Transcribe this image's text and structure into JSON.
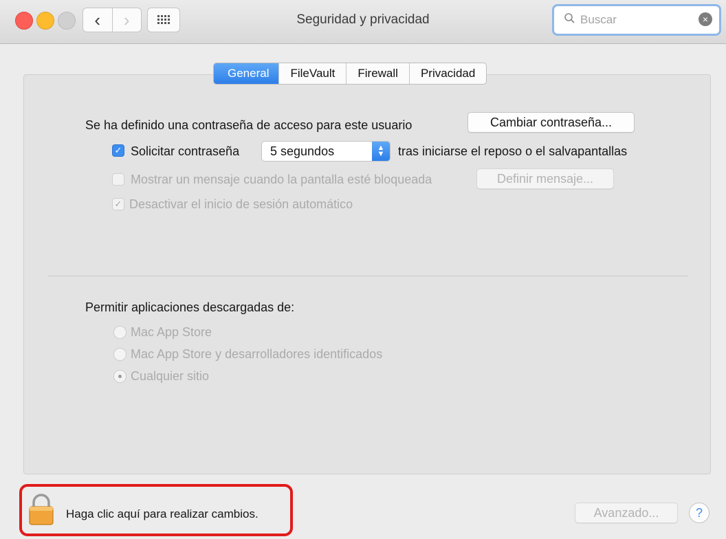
{
  "window": {
    "title": "Seguridad y privacidad",
    "nav_back": "‹",
    "nav_forward": "›"
  },
  "search": {
    "placeholder": "Buscar"
  },
  "tabs": [
    {
      "label": "General",
      "active": true
    },
    {
      "label": "FileVault",
      "active": false
    },
    {
      "label": "Firewall",
      "active": false
    },
    {
      "label": "Privacidad",
      "active": false
    }
  ],
  "general": {
    "password_set_label": "Se ha definido una contraseña de acceso para este usuario",
    "change_password_button": "Cambiar contraseña...",
    "require_password": {
      "label": "Solicitar contraseña",
      "checked": true,
      "delay_value": "5 segundos",
      "suffix": "tras iniciarse el reposo o el salvapantallas"
    },
    "show_message": {
      "label": "Mostrar un mensaje cuando la pantalla esté bloqueada",
      "checked": false,
      "button": "Definir mensaje..."
    },
    "disable_auto_login": {
      "label": "Desactivar el inicio de sesión automático",
      "checked": true
    }
  },
  "downloads": {
    "label": "Permitir aplicaciones descargadas de:",
    "options": [
      {
        "label": "Mac App Store",
        "selected": false
      },
      {
        "label": "Mac App Store y desarrolladores identificados",
        "selected": false
      },
      {
        "label": "Cualquier sitio",
        "selected": true
      }
    ]
  },
  "footer": {
    "lock_text": "Haga clic aquí para realizar cambios.",
    "advanced_button": "Avanzado...",
    "help_button": "?"
  },
  "colors": {
    "accent_blue": "#3d8ef1",
    "highlight_red": "#e11b1b"
  }
}
